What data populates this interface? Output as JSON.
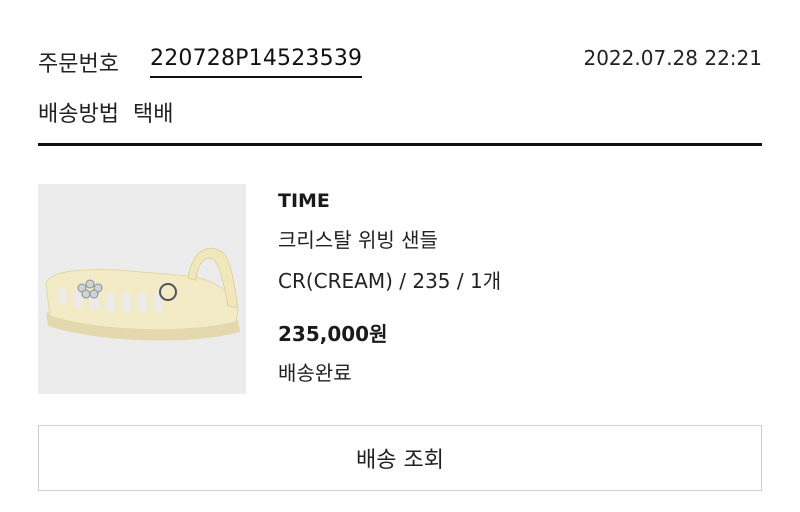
{
  "order": {
    "number_label": "주문번호",
    "number": "220728P14523539",
    "date": "2022.07.28 22:21",
    "shipping_method_label": "배송방법",
    "shipping_method": "택배"
  },
  "product": {
    "brand": "TIME",
    "name": "크리스탈 위빙 샌들",
    "option": "CR(CREAM)  / 235 / 1개",
    "price": "235,000원",
    "status": "배송완료"
  },
  "actions": {
    "track_label": "배송 조회"
  }
}
